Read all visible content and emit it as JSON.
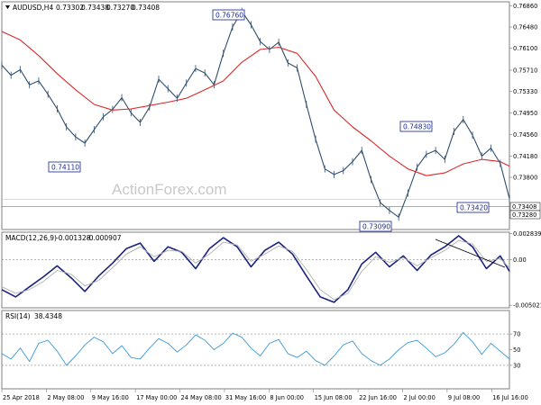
{
  "chart_data": [
    {
      "type": "line",
      "panel": "price",
      "header": {
        "symbol": "AUDUSD,H4",
        "open": "0.73302",
        "high": "0.73438",
        "low": "0.73270",
        "close": "0.73408"
      },
      "watermark": "ActionForex.com",
      "ylim": [
        0.7287,
        0.7693
      ],
      "yticks": [
        "0.76860",
        "0.76480",
        "0.76100",
        "0.75710",
        "0.75330",
        "0.74950",
        "0.74560",
        "0.74180",
        "0.73800"
      ],
      "current_price_labels": [
        "0.73408",
        "0.73280"
      ],
      "xticks": [
        "25 Apr 2018",
        "2 May 08:00",
        "9 May 16:00",
        "17 May 00:00",
        "24 May 08:00",
        "31 May 16:00",
        "8 Jun 00:00",
        "15 Jun 08:00",
        "22 Jun 16:00",
        "2 Jul 00:00",
        "9 Jul 08:00",
        "16 Jul 16:00"
      ],
      "series": [
        {
          "x": [
            0,
            2,
            4,
            6,
            8,
            10,
            12,
            14,
            16,
            18,
            20,
            22,
            24,
            26,
            28,
            30,
            32,
            34,
            36,
            38,
            40,
            42,
            44,
            46,
            48,
            50,
            52,
            54,
            56,
            58,
            60,
            62,
            64,
            66,
            68,
            70,
            72,
            74,
            76,
            78,
            80,
            82,
            84,
            86,
            88,
            90,
            92,
            94,
            96,
            98,
            100,
            102,
            104,
            106,
            108,
            110
          ],
          "values": [
            0.758,
            0.7562,
            0.7572,
            0.7545,
            0.7552,
            0.7528,
            0.7502,
            0.747,
            0.7452,
            0.7441,
            0.7465,
            0.7488,
            0.7501,
            0.7522,
            0.7495,
            0.7478,
            0.7505,
            0.7555,
            0.7538,
            0.7521,
            0.7548,
            0.7574,
            0.7566,
            0.7545,
            0.7601,
            0.7648,
            0.7676,
            0.7652,
            0.7622,
            0.7608,
            0.7621,
            0.7584,
            0.7575,
            0.751,
            0.7448,
            0.7395,
            0.7385,
            0.7392,
            0.7408,
            0.7428,
            0.7376,
            0.7335,
            0.7321,
            0.7309,
            0.7352,
            0.7398,
            0.7421,
            0.7428,
            0.7412,
            0.7462,
            0.7483,
            0.7455,
            0.7418,
            0.7432,
            0.7405,
            0.7342
          ]
        },
        {
          "x": [
            0,
            4,
            8,
            12,
            16,
            20,
            24,
            28,
            32,
            36,
            40,
            44,
            48,
            52,
            56,
            60,
            64,
            68,
            72,
            76,
            80,
            84,
            88,
            92,
            96,
            100,
            104,
            108,
            110
          ],
          "values": [
            0.764,
            0.7625,
            0.7597,
            0.7565,
            0.7536,
            0.751,
            0.75,
            0.7502,
            0.7508,
            0.7514,
            0.7521,
            0.7536,
            0.7552,
            0.7585,
            0.7608,
            0.7612,
            0.7601,
            0.756,
            0.75,
            0.747,
            0.7445,
            0.7418,
            0.7395,
            0.7383,
            0.7388,
            0.7404,
            0.7412,
            0.7408,
            0.74
          ]
        }
      ],
      "annotations": [
        "0.76760",
        "0.74110",
        "0.74830",
        "0.73420",
        "0.73090"
      ]
    },
    {
      "type": "line",
      "panel": "macd",
      "header": {
        "label": "MACD(12,26,9)",
        "main": "-0.001328",
        "signal": "-0.000907"
      },
      "ylim": [
        -0.0053,
        0.003
      ],
      "yticks": [
        "0.002839",
        "0.00",
        "-0.005021"
      ],
      "series": [
        {
          "x": [
            0,
            3,
            6,
            9,
            12,
            15,
            18,
            21,
            24,
            27,
            30,
            33,
            36,
            39,
            42,
            45,
            48,
            51,
            54,
            57,
            60,
            63,
            66,
            69,
            72,
            75,
            78,
            81,
            84,
            87,
            90,
            93,
            96,
            99,
            102,
            105,
            108,
            110
          ],
          "values": [
            -0.0033,
            -0.0041,
            -0.003,
            -0.0019,
            -0.0007,
            -0.002,
            -0.0035,
            -0.0018,
            -0.0004,
            0.0012,
            0.0018,
            -0.0002,
            0.0014,
            0.0008,
            -0.001,
            0.0012,
            0.0024,
            0.0014,
            -0.0008,
            0.001,
            0.0019,
            0.0006,
            -0.0018,
            -0.0041,
            -0.0047,
            -0.0033,
            -0.0005,
            0.0008,
            -0.0008,
            0.0004,
            -0.0012,
            0.0005,
            0.0014,
            0.0026,
            0.0014,
            -0.001,
            0.0004,
            -0.0013
          ]
        },
        {
          "x": [
            0,
            3,
            6,
            9,
            12,
            15,
            18,
            21,
            24,
            27,
            30,
            33,
            36,
            39,
            42,
            45,
            48,
            51,
            54,
            57,
            60,
            63,
            66,
            69,
            72,
            75,
            78,
            81,
            84,
            87,
            90,
            93,
            96,
            99,
            102,
            105,
            108,
            110
          ],
          "values": [
            -0.003,
            -0.0037,
            -0.0033,
            -0.0024,
            -0.0012,
            -0.0016,
            -0.0029,
            -0.0023,
            -0.0009,
            0.0006,
            0.0014,
            0.0003,
            0.001,
            0.0009,
            -0.0004,
            0.0006,
            0.0019,
            0.0016,
            -0.0002,
            0.0006,
            0.0015,
            0.0009,
            -0.0011,
            -0.0033,
            -0.0044,
            -0.0037,
            -0.0013,
            0.0003,
            -0.0003,
            0.0002,
            -0.0007,
            0.0002,
            0.001,
            0.0021,
            0.0017,
            -0.0002,
            0.0001,
            -0.0009
          ]
        }
      ]
    },
    {
      "type": "line",
      "panel": "rsi",
      "header": {
        "label": "RSI(14)",
        "value": "38.4348"
      },
      "ylim": [
        0,
        100
      ],
      "yticks": [
        "70",
        "50",
        "30"
      ],
      "series": [
        {
          "x": [
            0,
            2,
            4,
            6,
            8,
            10,
            12,
            14,
            16,
            18,
            20,
            22,
            24,
            26,
            28,
            30,
            32,
            34,
            36,
            38,
            40,
            42,
            44,
            46,
            48,
            50,
            52,
            54,
            56,
            58,
            60,
            62,
            64,
            66,
            68,
            70,
            72,
            74,
            76,
            78,
            80,
            82,
            84,
            86,
            88,
            90,
            92,
            94,
            96,
            98,
            100,
            102,
            104,
            106,
            108,
            110
          ],
          "values": [
            45,
            38,
            52,
            35,
            58,
            62,
            48,
            30,
            42,
            56,
            66,
            60,
            45,
            55,
            40,
            38,
            52,
            64,
            58,
            47,
            56,
            69,
            62,
            50,
            58,
            71,
            66,
            52,
            42,
            58,
            63,
            45,
            40,
            48,
            36,
            30,
            42,
            56,
            61,
            45,
            36,
            30,
            38,
            50,
            59,
            62,
            52,
            41,
            46,
            57,
            72,
            60,
            44,
            58,
            48,
            38
          ]
        }
      ]
    }
  ]
}
